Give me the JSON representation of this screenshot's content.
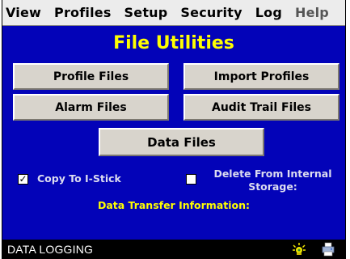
{
  "menu": {
    "items": [
      "View",
      "Profiles",
      "Setup",
      "Security",
      "Log",
      "Help"
    ]
  },
  "title": "File Utilities",
  "buttons": {
    "profile_files": "Profile Files",
    "import_profiles": "Import Profiles",
    "alarm_files": "Alarm Files",
    "audit_trail_files": "Audit Trail Files",
    "data_files": "Data Files"
  },
  "options": {
    "copy_to_istick": {
      "label": "Copy To I-Stick",
      "checked": true
    },
    "delete_from_internal": {
      "label_line1": "Delete From Internal",
      "label_line2": "Storage:",
      "checked": false
    }
  },
  "info_label": "Data Transfer Information:",
  "status": {
    "text": "DATA LOGGING",
    "icons": [
      "alarm-light-icon",
      "printer-icon"
    ]
  },
  "colors": {
    "background": "#0303b8",
    "title": "#ffff00",
    "button_face": "#d8d4cc"
  }
}
